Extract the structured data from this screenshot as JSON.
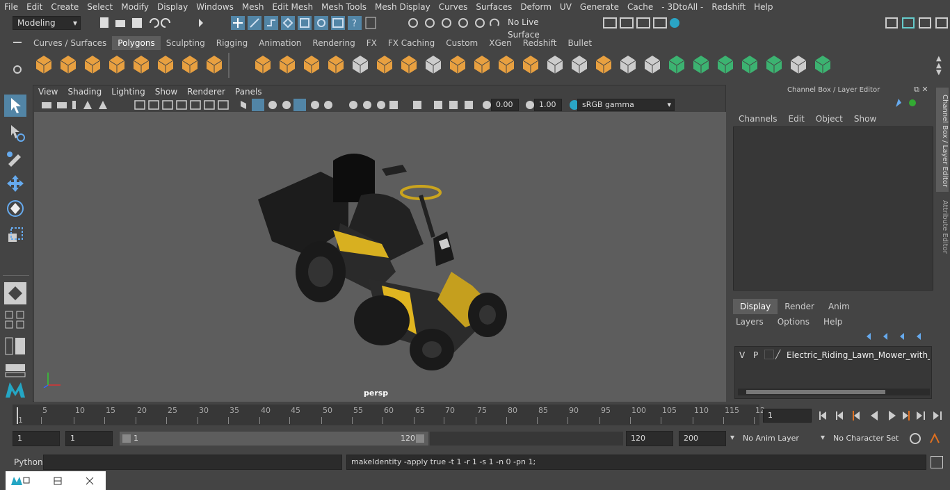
{
  "menubar": [
    "File",
    "Edit",
    "Create",
    "Select",
    "Modify",
    "Display",
    "Windows",
    "Mesh",
    "Edit Mesh",
    "Mesh Tools",
    "Mesh Display",
    "Curves",
    "Surfaces",
    "Deform",
    "UV",
    "Generate",
    "Cache",
    "- 3DtoAll -",
    "Redshift",
    "Help"
  ],
  "status": {
    "mode": "Modeling",
    "live_surface": "No Live Surface"
  },
  "shelf": {
    "tabs": [
      "Curves / Surfaces",
      "Polygons",
      "Sculpting",
      "Rigging",
      "Animation",
      "Rendering",
      "FX",
      "FX Caching",
      "Custom",
      "XGen",
      "Redshift",
      "Bullet"
    ],
    "active": "Polygons"
  },
  "viewport": {
    "menu": [
      "View",
      "Shading",
      "Lighting",
      "Show",
      "Renderer",
      "Panels"
    ],
    "field_a": "0.00",
    "field_b": "1.00",
    "colorspace": "sRGB gamma",
    "camera": "persp"
  },
  "channelbox": {
    "title": "Channel Box / Layer Editor",
    "menu": [
      "Channels",
      "Edit",
      "Object",
      "Show"
    ],
    "side_tabs": [
      "Channel Box / Layer Editor",
      "Attribute Editor"
    ],
    "layer_tabs": [
      "Display",
      "Render",
      "Anim"
    ],
    "layer_menu": [
      "Layers",
      "Options",
      "Help"
    ],
    "layer": {
      "v": "V",
      "p": "P",
      "name": "Electric_Riding_Lawn_Mower_with_Bag"
    }
  },
  "timeline": {
    "ticks": [
      "1",
      "5",
      "10",
      "15",
      "20",
      "25",
      "30",
      "35",
      "40",
      "45",
      "50",
      "55",
      "60",
      "65",
      "70",
      "75",
      "80",
      "85",
      "90",
      "95",
      "100",
      "105",
      "110",
      "115",
      "12"
    ],
    "current_frame": "1"
  },
  "range": {
    "start": "1",
    "start2": "1",
    "slider_start": "1",
    "slider_end": "120",
    "end": "120",
    "end2": "200",
    "anim_layer": "No Anim Layer",
    "char_set": "No Character Set"
  },
  "cmd": {
    "lang": "Python",
    "output": "makeIdentity -apply true -t 1 -r 1 -s 1 -n 0 -pn 1;"
  }
}
